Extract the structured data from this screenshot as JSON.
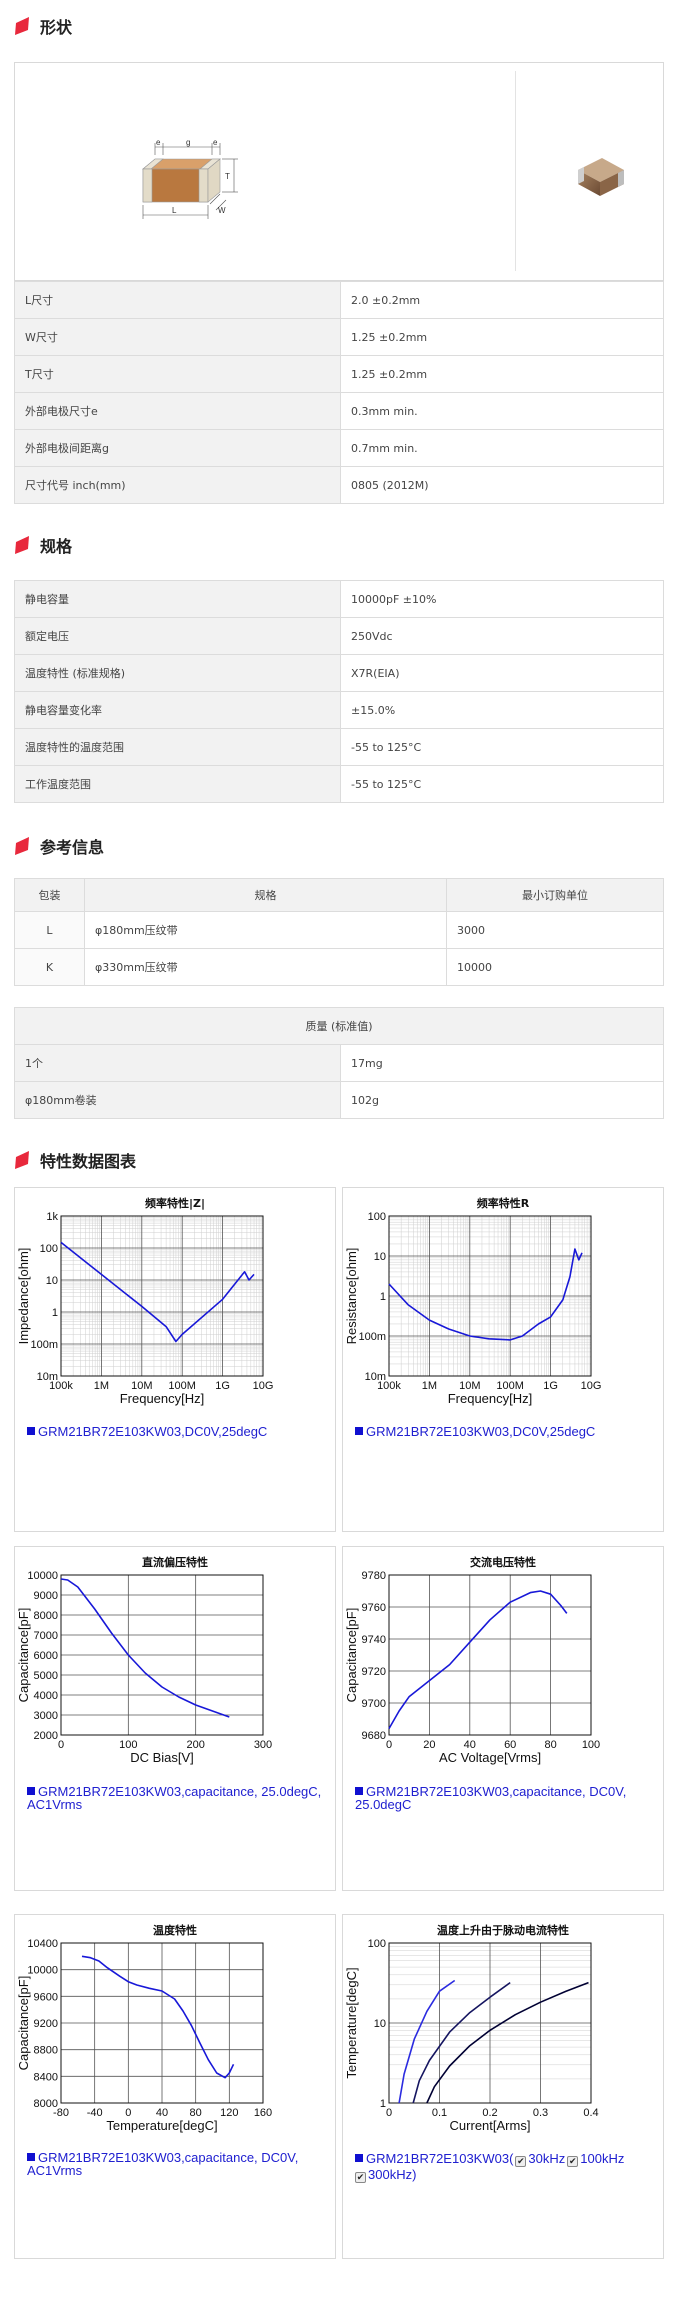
{
  "sections": {
    "shape": "形状",
    "spec": "规格",
    "ref": "参考信息",
    "charts": "特性数据图表"
  },
  "drawing": {
    "e1": "e",
    "g": "g",
    "e2": "e",
    "T": "T",
    "L": "L",
    "W": "W"
  },
  "dimensions": [
    {
      "k": "L尺寸",
      "v": "2.0 ±0.2mm"
    },
    {
      "k": "W尺寸",
      "v": "1.25 ±0.2mm"
    },
    {
      "k": "T尺寸",
      "v": "1.25 ±0.2mm"
    },
    {
      "k": "外部电极尺寸e",
      "v": "0.3mm min."
    },
    {
      "k": "外部电极间距离g",
      "v": "0.7mm min."
    },
    {
      "k": "尺寸代号 inch(mm)",
      "v": "0805 (2012M)"
    }
  ],
  "specs": [
    {
      "k": "静电容量",
      "v": "10000pF ±10%"
    },
    {
      "k": "额定电压",
      "v": "250Vdc"
    },
    {
      "k": "温度特性 (标准规格)",
      "v": "X7R(EIA)"
    },
    {
      "k": "静电容量变化率",
      "v": "±15.0%"
    },
    {
      "k": "温度特性的温度范围",
      "v": "-55 to 125°C"
    },
    {
      "k": "工作温度范围",
      "v": "-55 to 125°C"
    }
  ],
  "packaging": {
    "headers": [
      "包装",
      "规格",
      "最小订购单位"
    ],
    "rows": [
      {
        "code": "L",
        "spec": "φ180mm压纹带",
        "moq": "3000"
      },
      {
        "code": "K",
        "spec": "φ330mm压纹带",
        "moq": "10000"
      }
    ]
  },
  "mass": {
    "header": "质量 (标准值)",
    "rows": [
      {
        "k": "1个",
        "v": "17mg"
      },
      {
        "k": "φ180mm卷装",
        "v": "102g"
      }
    ]
  },
  "chart_data": [
    {
      "type": "line",
      "title": "频率特性|Z|",
      "xlabel": "Frequency[Hz]",
      "ylabel": "Impedance[ohm]",
      "xscale": "log",
      "yscale": "log",
      "xlim": [
        100000,
        10000000000
      ],
      "ylim": [
        0.01,
        1000
      ],
      "xticks": [
        "100k",
        "1M",
        "10M",
        "100M",
        "1G",
        "10G"
      ],
      "yticks": [
        "1k",
        "100",
        "10",
        "1",
        "100m",
        "10m"
      ],
      "legend": "GRM21BR72E103KW03,DC0V,25degC",
      "series": [
        {
          "x": [
            100000,
            1000000,
            10000000,
            40000000,
            70000000,
            100000000,
            1000000000,
            3500000000,
            4500000000,
            6000000000
          ],
          "y": [
            150,
            15,
            1.5,
            0.35,
            0.12,
            0.2,
            2.5,
            18,
            10,
            15
          ]
        }
      ]
    },
    {
      "type": "line",
      "title": "频率特性R",
      "xlabel": "Frequency[Hz]",
      "ylabel": "Resistance[ohm]",
      "xscale": "log",
      "yscale": "log",
      "xlim": [
        100000,
        10000000000
      ],
      "ylim": [
        0.01,
        100
      ],
      "xticks": [
        "100k",
        "1M",
        "10M",
        "100M",
        "1G",
        "10G"
      ],
      "yticks": [
        "100",
        "10",
        "1",
        "100m",
        "10m"
      ],
      "legend": "GRM21BR72E103KW03,DC0V,25degC",
      "series": [
        {
          "x": [
            100000,
            300000,
            1000000,
            3000000,
            10000000,
            30000000,
            100000000,
            200000000,
            500000000,
            1000000000,
            2000000000,
            3000000000,
            4000000000,
            5000000000,
            6000000000
          ],
          "y": [
            2,
            0.6,
            0.25,
            0.15,
            0.1,
            0.085,
            0.08,
            0.1,
            0.2,
            0.3,
            0.8,
            3,
            15,
            8,
            12
          ]
        }
      ]
    },
    {
      "type": "line",
      "title": "直流偏压特性",
      "xlabel": "DC Bias[V]",
      "ylabel": "Capacitance[pF]",
      "xlim": [
        0,
        300
      ],
      "ylim": [
        2000,
        10000
      ],
      "xticks": [
        "0",
        "100",
        "200",
        "300"
      ],
      "yticks": [
        "10000",
        "9000",
        "8000",
        "7000",
        "6000",
        "5000",
        "4000",
        "3000",
        "2000"
      ],
      "legend": "GRM21BR72E103KW03,capacitance, 25.0degC, AC1Vrms",
      "series": [
        {
          "x": [
            0,
            10,
            25,
            50,
            75,
            100,
            125,
            150,
            175,
            200,
            225,
            250
          ],
          "y": [
            9800,
            9750,
            9400,
            8300,
            7100,
            6000,
            5100,
            4400,
            3900,
            3500,
            3200,
            2900
          ]
        }
      ]
    },
    {
      "type": "line",
      "title": "交流电压特性",
      "xlabel": "AC Voltage[Vrms]",
      "ylabel": "Capacitance[pF]",
      "xlim": [
        0,
        100
      ],
      "ylim": [
        9680,
        9780
      ],
      "xticks": [
        "0",
        "20",
        "40",
        "60",
        "80",
        "100"
      ],
      "yticks": [
        "9780",
        "9760",
        "9740",
        "9720",
        "9700",
        "9680"
      ],
      "legend": "GRM21BR72E103KW03,capacitance, DC0V, 25.0degC",
      "series": [
        {
          "x": [
            0,
            5,
            10,
            20,
            30,
            40,
            50,
            60,
            70,
            75,
            80,
            85,
            88
          ],
          "y": [
            9684,
            9695,
            9704,
            9714,
            9724,
            9738,
            9752,
            9763,
            9769,
            9770,
            9768,
            9761,
            9756
          ]
        }
      ]
    },
    {
      "type": "line",
      "title": "温度特性",
      "xlabel": "Temperature[degC]",
      "ylabel": "Capacitance[pF]",
      "xlim": [
        -80,
        160
      ],
      "ylim": [
        8000,
        10400
      ],
      "xticks": [
        "-80",
        "-40",
        "0",
        "40",
        "80",
        "120",
        "160"
      ],
      "yticks": [
        "10400",
        "10000",
        "9600",
        "9200",
        "8800",
        "8400",
        "8000"
      ],
      "legend": "GRM21BR72E103KW03,capacitance, DC0V, AC1Vrms",
      "series": [
        {
          "x": [
            -55,
            -45,
            -35,
            -25,
            -10,
            0,
            10,
            25,
            40,
            55,
            65,
            75,
            85,
            95,
            105,
            115,
            120,
            125
          ],
          "y": [
            10200,
            10180,
            10130,
            10030,
            9900,
            9820,
            9770,
            9720,
            9680,
            9560,
            9380,
            9160,
            8900,
            8650,
            8450,
            8380,
            8450,
            8580
          ]
        }
      ]
    },
    {
      "type": "line",
      "title": "温度上升由于脉动电流特性",
      "xlabel": "Current[Arms]",
      "ylabel": "Temperature[degC]",
      "yscale": "log",
      "xlim": [
        0,
        0.4
      ],
      "ylim": [
        1,
        100
      ],
      "xticks": [
        "0",
        "0.1",
        "0.2",
        "0.3",
        "0.4"
      ],
      "yticks": [
        "100",
        "10",
        "1"
      ],
      "legend": "GRM21BR72E103KW03(",
      "legend_items": [
        "30kHz",
        "100kHz",
        "300kHz)"
      ],
      "series": [
        {
          "name": "30kHz",
          "x": [
            0.02,
            0.03,
            0.05,
            0.075,
            0.1,
            0.13
          ],
          "y": [
            1,
            2.3,
            6.3,
            14,
            25,
            34
          ]
        },
        {
          "name": "100kHz",
          "x": [
            0.048,
            0.06,
            0.08,
            0.12,
            0.16,
            0.2,
            0.24
          ],
          "y": [
            1,
            1.9,
            3.4,
            7.7,
            13.5,
            21,
            32
          ]
        },
        {
          "name": "300kHz",
          "x": [
            0.075,
            0.09,
            0.12,
            0.16,
            0.2,
            0.25,
            0.3,
            0.35,
            0.395
          ],
          "y": [
            1,
            1.6,
            2.9,
            5.2,
            8.1,
            12.7,
            18.2,
            24.8,
            32
          ]
        }
      ]
    }
  ]
}
